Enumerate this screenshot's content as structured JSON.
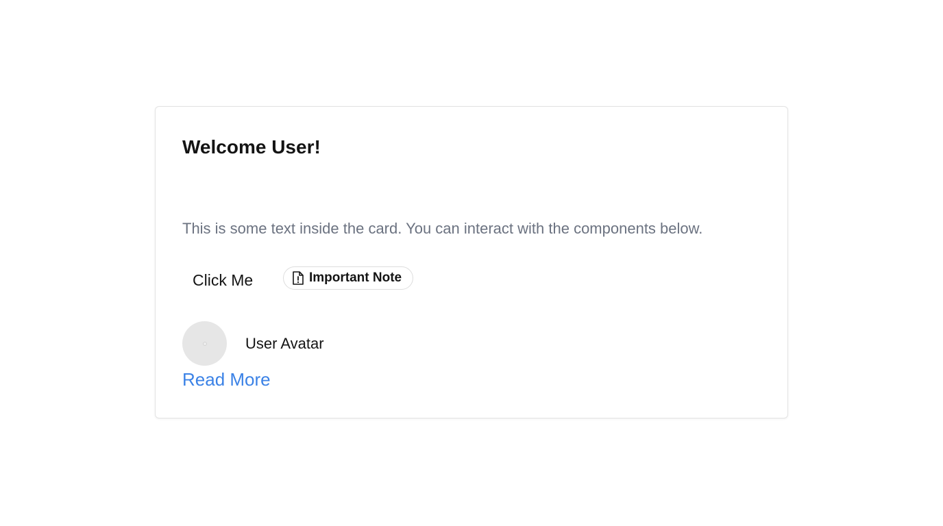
{
  "card": {
    "title": "Welcome User!",
    "text": "This is some text inside the card. You can interact with the components below.",
    "button_label": "Click Me",
    "chip": {
      "label": "Important Note",
      "icon": "file-alert-icon"
    },
    "avatar": {
      "label": "User Avatar"
    },
    "link_label": "Read More"
  },
  "colors": {
    "link": "#3b82e6",
    "muted_text": "#6b7280",
    "avatar_bg": "#e6e6e6"
  }
}
